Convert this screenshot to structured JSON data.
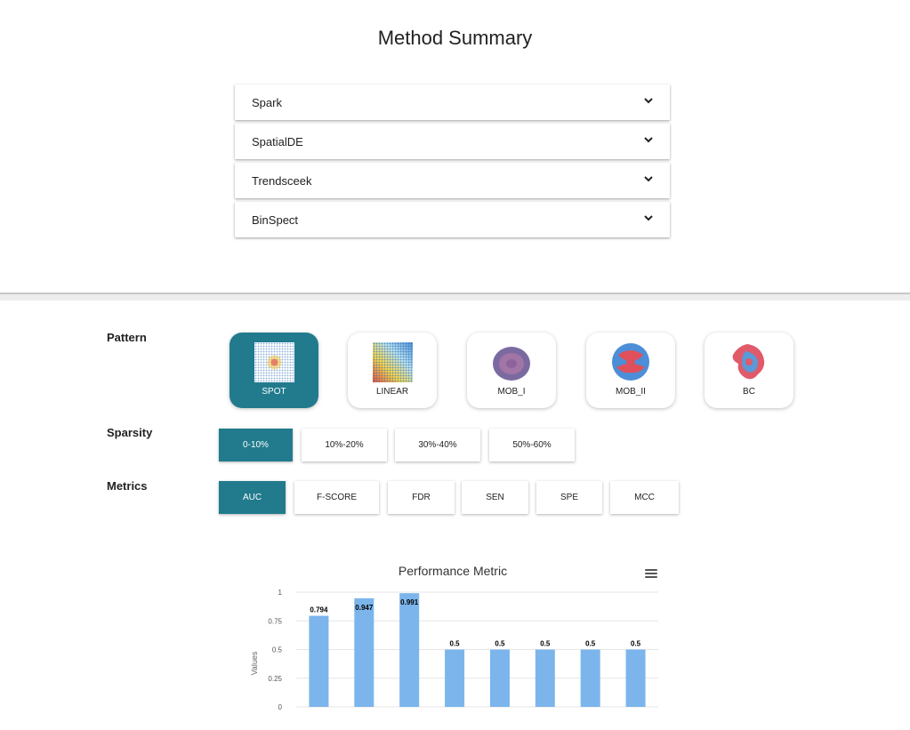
{
  "summary": {
    "title": "Method Summary",
    "methods": [
      {
        "label": "Spark"
      },
      {
        "label": "SpatialDE"
      },
      {
        "label": "Trendsceek"
      },
      {
        "label": "BinSpect"
      }
    ]
  },
  "filters": {
    "pattern_label": "Pattern",
    "patterns": [
      {
        "label": "SPOT",
        "icon": "spot-pattern-icon",
        "selected": true
      },
      {
        "label": "LINEAR",
        "icon": "linear-pattern-icon",
        "selected": false
      },
      {
        "label": "MOB_I",
        "icon": "mob-i-pattern-icon",
        "selected": false
      },
      {
        "label": "MOB_II",
        "icon": "mob-ii-pattern-icon",
        "selected": false
      },
      {
        "label": "BC",
        "icon": "bc-pattern-icon",
        "selected": false
      }
    ],
    "sparsity_label": "Sparsity",
    "sparsity": [
      {
        "label": "0-10%",
        "selected": true
      },
      {
        "label": "10%-20%",
        "selected": false
      },
      {
        "label": "30%-40%",
        "selected": false
      },
      {
        "label": "50%-60%",
        "selected": false
      }
    ],
    "metrics_label": "Metrics",
    "metrics": [
      {
        "label": "AUC",
        "selected": true
      },
      {
        "label": "F-SCORE",
        "selected": false
      },
      {
        "label": "FDR",
        "selected": false
      },
      {
        "label": "SEN",
        "selected": false
      },
      {
        "label": "SPE",
        "selected": false
      },
      {
        "label": "MCC",
        "selected": false
      }
    ]
  },
  "colors": {
    "accent": "#217b8d",
    "bar": "#7cb5ec",
    "grid": "#e6e6e6"
  },
  "chart_data": {
    "type": "bar",
    "title": "Performance Metric",
    "xlabel": "",
    "ylabel": "Values",
    "ylim": [
      0,
      1
    ],
    "yticks": [
      "0",
      "0.25",
      "0.5",
      "0.75",
      "1"
    ],
    "grid": true,
    "series": [
      {
        "values": [
          0.794,
          0.947,
          0.991,
          0.5,
          0.5,
          0.5,
          0.5,
          0.5
        ],
        "labels": [
          "0.794",
          "0.947",
          "0.991",
          "0.5",
          "0.5",
          "0.5",
          "0.5",
          "0.5"
        ]
      }
    ]
  }
}
